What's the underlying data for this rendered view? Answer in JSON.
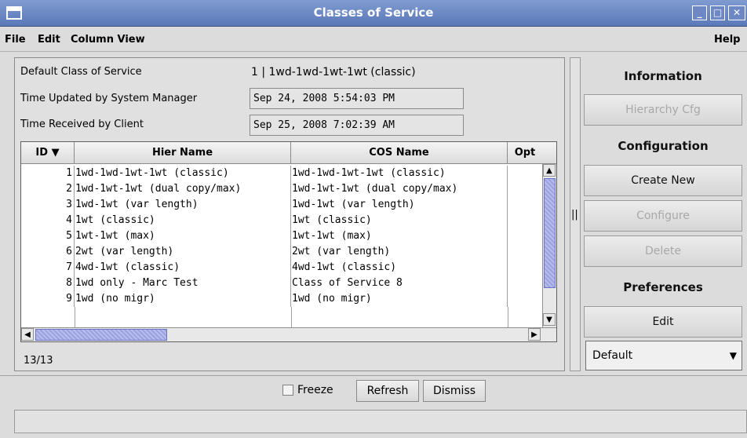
{
  "window": {
    "title": "Classes of Service"
  },
  "menu": {
    "file": "File",
    "edit": "Edit",
    "column_view": "Column View",
    "help": "Help"
  },
  "info": {
    "default_cos_label": "Default Class of Service",
    "default_cos_value": "1 | 1wd-1wd-1wt-1wt (classic)",
    "time_updated_label": "Time Updated by System Manager",
    "time_updated_value": "Sep 24, 2008 5:54:03 PM",
    "time_received_label": "Time Received by Client",
    "time_received_value": "Sep 25, 2008 7:02:39 AM"
  },
  "table": {
    "columns": {
      "id": "ID ▼",
      "hier": "Hier Name",
      "cos": "COS Name",
      "opt": "Opt"
    },
    "rows": [
      {
        "id": "1",
        "hier": "1wd-1wd-1wt-1wt (classic)",
        "cos": "1wd-1wd-1wt-1wt (classic)"
      },
      {
        "id": "2",
        "hier": "1wd-1wt-1wt (dual copy/max)",
        "cos": "1wd-1wt-1wt (dual copy/max)"
      },
      {
        "id": "3",
        "hier": "1wd-1wt (var length)",
        "cos": "1wd-1wt (var length)"
      },
      {
        "id": "4",
        "hier": "1wt (classic)",
        "cos": "1wt (classic)"
      },
      {
        "id": "5",
        "hier": "1wt-1wt (max)",
        "cos": "1wt-1wt (max)"
      },
      {
        "id": "6",
        "hier": "2wt (var length)",
        "cos": "2wt (var length)"
      },
      {
        "id": "7",
        "hier": "4wd-1wt (classic)",
        "cos": "4wd-1wt (classic)"
      },
      {
        "id": "8",
        "hier": "1wd only - Marc Test",
        "cos": "Class of Service 8"
      },
      {
        "id": "9",
        "hier": "1wd (no migr)",
        "cos": "1wd (no migr)"
      }
    ],
    "count": "13/13"
  },
  "right_panel": {
    "information": "Information",
    "hierarchy_cfg": "Hierarchy Cfg",
    "configuration": "Configuration",
    "create_new": "Create New",
    "configure": "Configure",
    "delete": "Delete",
    "preferences": "Preferences",
    "edit": "Edit",
    "preference_select": "Default"
  },
  "divider_glyph": "||",
  "bottom": {
    "freeze": "Freeze",
    "refresh": "Refresh",
    "dismiss": "Dismiss"
  },
  "colors": {
    "titlebar": "#6d88c4",
    "scroll_thumb": "#9aa2e0"
  }
}
